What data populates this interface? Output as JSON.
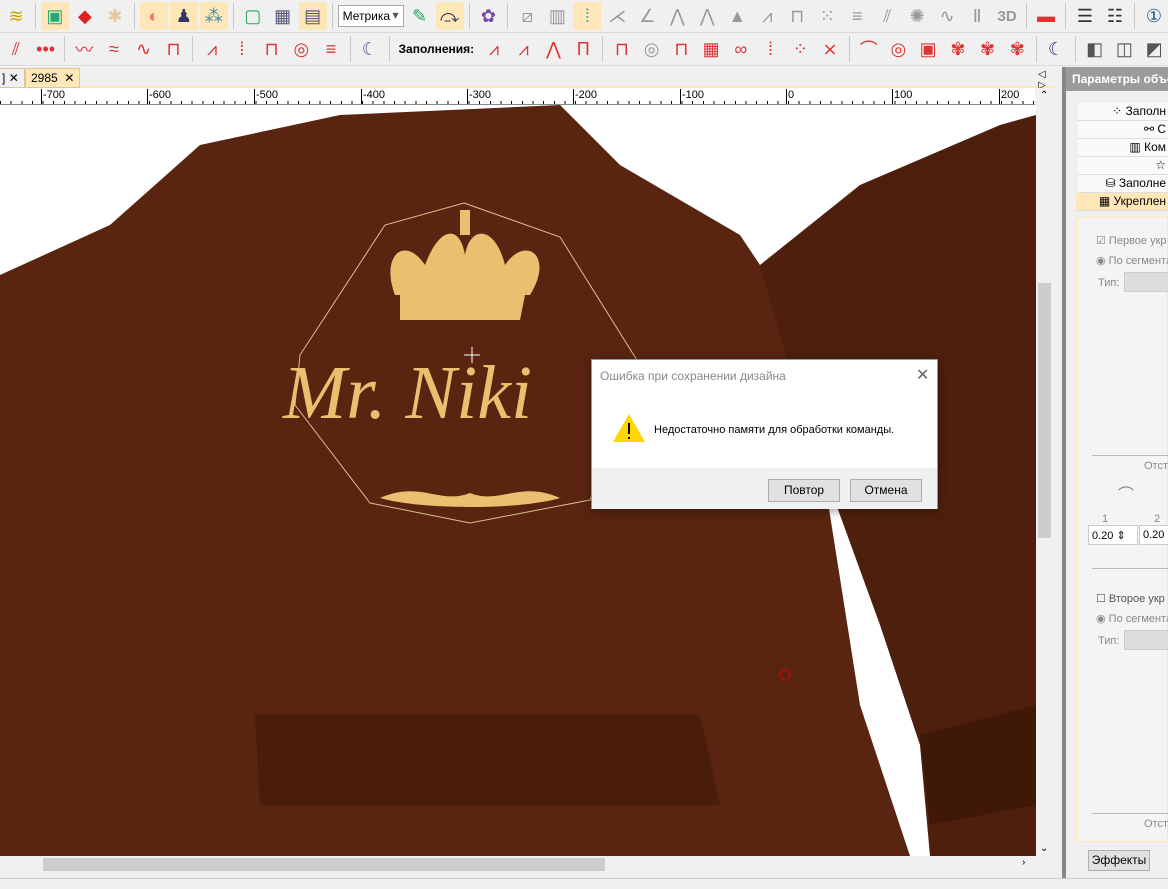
{
  "toolbar1": {
    "units_select": "Метрика",
    "icons": [
      "fish-icon",
      "picture-icon",
      "shapes-icon",
      "star-shape-icon",
      "hoop-icon",
      "garment-icon",
      "thread-colors-icon",
      "hoop-frame-icon",
      "grid-icon",
      "grid-guides-icon",
      "units-select",
      "stitch-edit-icon",
      "travel-icon",
      "trim-icon",
      "satin-icon",
      "column-icon",
      "tatami-icon"
    ],
    "label_3d": "3D"
  },
  "toolbar2": {
    "fills_label": "Заполнения:"
  },
  "tabs": [
    {
      "label": "]"
    },
    {
      "label": "2985"
    }
  ],
  "ruler": {
    "labels": [
      "-700",
      "-600",
      "-500",
      "-400",
      "-300",
      "-200",
      "-100",
      "0",
      "100",
      "200"
    ]
  },
  "design": {
    "text": "Mr. Niki"
  },
  "dialog": {
    "title": "Ошибка при сохранении дизайна",
    "message": "Недостаточно памяти для обработки команды.",
    "retry": "Повтор",
    "cancel": "Отмена",
    "colors": {
      "warning": "#ffd700"
    }
  },
  "panel": {
    "title": "Параметры объе",
    "tabs": [
      "Заполн",
      "С",
      "Ком",
      "☆",
      "Заполне",
      "Укреплен"
    ],
    "first": {
      "checkbox": "Первое укр",
      "radio": "По сегмента",
      "type_label": "Тип:",
      "offset_label": "Отст",
      "col1": "1",
      "col2": "2",
      "v1": "0.20",
      "v2": "0.20"
    },
    "second": {
      "checkbox": "Второе укр",
      "radio": "По сегмента",
      "type_label": "Тип:"
    },
    "offset_bottom": "Отст",
    "effects": "Эффекты"
  }
}
